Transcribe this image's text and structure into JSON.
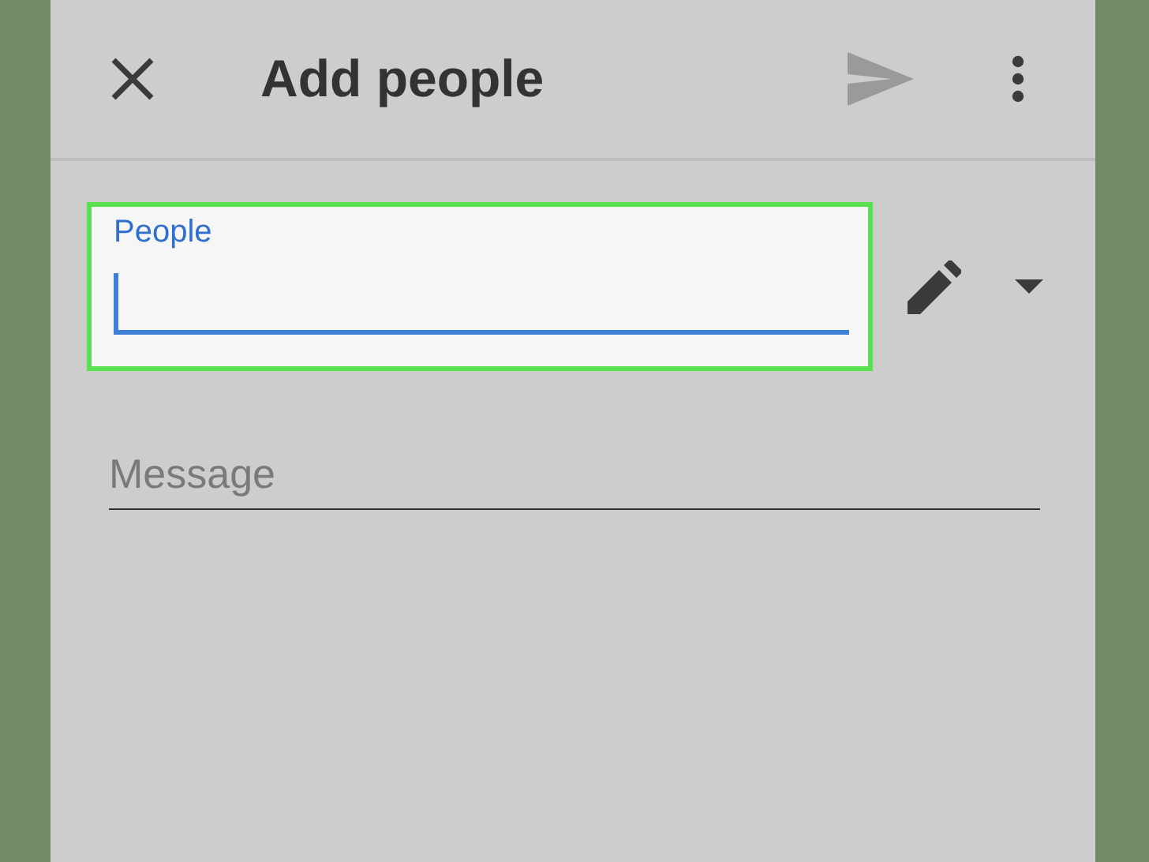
{
  "app_bar": {
    "title": "Add people"
  },
  "people_field": {
    "label": "People",
    "focused": true,
    "highlighted": true
  },
  "message_field": {
    "placeholder": "Message"
  }
}
